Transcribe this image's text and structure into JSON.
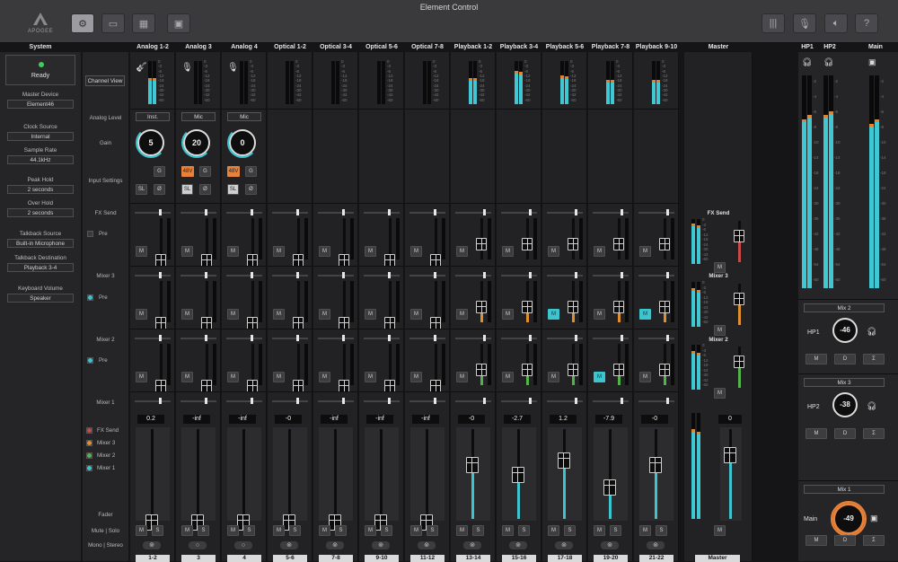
{
  "window": {
    "title": "Element Control"
  },
  "logo": {
    "text": "APOGEE"
  },
  "headers": {
    "system": "System",
    "channels": [
      "Analog 1-2",
      "Analog 3",
      "Analog 4",
      "Optical 1-2",
      "Optical 3-4",
      "Optical 5-6",
      "Optical 7-8",
      "Playback 1-2",
      "Playback 3-4",
      "Playback 5-6",
      "Playback 7-8",
      "Playback 9-10"
    ],
    "master": "Master",
    "outputs": [
      "HP1",
      "HP2",
      "Main"
    ]
  },
  "system": {
    "status": "Ready",
    "items": [
      {
        "label": "Master Device",
        "value": "Element46"
      },
      {
        "label": "Clock Source",
        "value": "Internal"
      },
      {
        "label": "Sample Rate",
        "value": "44.1kHz"
      },
      {
        "label": "Peak Hold",
        "value": "2 seconds"
      },
      {
        "label": "Over Hold",
        "value": "2 seconds"
      },
      {
        "label": "Talkback Source",
        "value": "Built-in Microphone"
      },
      {
        "label": "Talkback Destination",
        "value": "Playback 3-4"
      },
      {
        "label": "Keyboard Volume",
        "value": "Speaker"
      }
    ]
  },
  "rowlabels": {
    "channel_view": "Channel View",
    "analog_level": "Analog Level",
    "gain": "Gain",
    "input_settings": "Input Settings",
    "fx_send": "FX Send",
    "pre": "Pre",
    "mixer3": "Mixer 3",
    "mixer2": "Mixer 2",
    "mixer1": "Mixer 1",
    "fader": "Fader",
    "mute_solo": "Mute | Solo",
    "mono_stereo": "Mono | Stereo"
  },
  "legend": [
    {
      "label": "FX Send",
      "color": "#c94848"
    },
    {
      "label": "Mixer 3",
      "color": "#e0902e"
    },
    {
      "label": "Mixer 2",
      "color": "#52b44a"
    },
    {
      "label": "Mixer 1",
      "color": "#3cc4cf"
    }
  ],
  "meter_scale": [
    "0",
    "-3",
    "-6",
    "-12",
    "-18",
    "-24",
    "-30",
    "-42",
    "-60"
  ],
  "out_scale": [
    "-2",
    "-4",
    "-6",
    "-8",
    "-10",
    "-14",
    "-18",
    "-24",
    "-30",
    "-36",
    "-42",
    "-48",
    "-54",
    "-60"
  ],
  "analog": [
    {
      "level": "Inst.",
      "gain": "5",
      "has48v": false
    },
    {
      "level": "Mic",
      "gain": "20",
      "has48v": true
    },
    {
      "level": "Mic",
      "gain": "0",
      "has48v": true
    }
  ],
  "input_buttons": {
    "g": "G",
    "v48": "48V",
    "sl": "SL",
    "phase": "Ø"
  },
  "mute": "M",
  "solo": "S",
  "channels_fader": [
    "0.2",
    "-inf",
    "-inf",
    "-0",
    "-inf",
    "-inf",
    "-inf",
    "-0",
    "-2.7",
    "1.2",
    "-7.9",
    "-0"
  ],
  "channel_numbers": [
    "1-2",
    "3",
    "4",
    "5-6",
    "7-8",
    "9-10",
    "11-12",
    "13-14",
    "15-16",
    "17-18",
    "19-20",
    "21-22"
  ],
  "master": {
    "fx_label": "FX Send",
    "mix3_label": "Mixer 3",
    "mix2_label": "Mixer 2",
    "fader_value": "0",
    "name": "Master"
  },
  "outputs": {
    "mix2": {
      "title": "Mix 2",
      "name": "HP1",
      "value": "-46"
    },
    "mix3": {
      "title": "Mix 3",
      "name": "HP2",
      "value": "-38"
    },
    "mix1": {
      "title": "Mix 1",
      "name": "Main",
      "value": "-49"
    },
    "buttons": {
      "m": "M",
      "d": "D",
      "sigma": "Σ"
    }
  }
}
